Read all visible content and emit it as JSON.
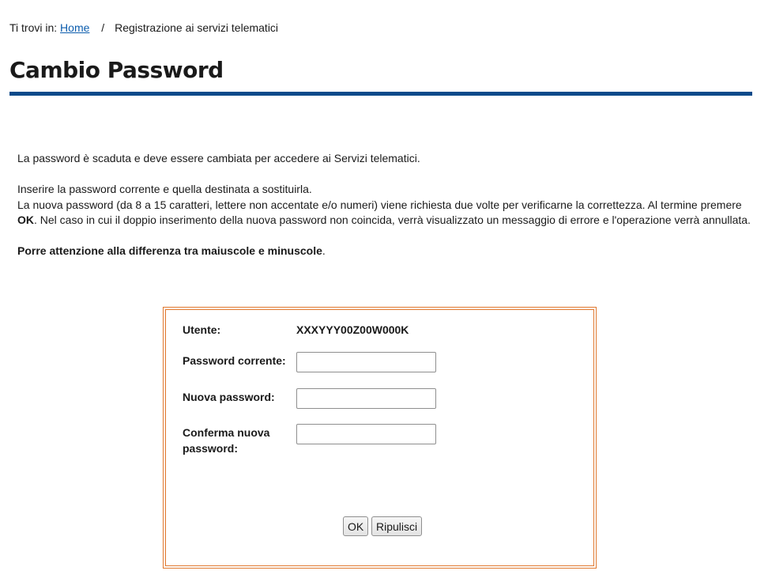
{
  "breadcrumb": {
    "prefix": "Ti trovi in:",
    "home": "Home",
    "separator": "/",
    "current": "Registrazione ai servizi telematici"
  },
  "page": {
    "title": "Cambio Password"
  },
  "intro": {
    "line1": "La password è scaduta e deve essere cambiata per accedere ai Servizi telematici.",
    "line2": "Inserire la password corrente e quella destinata a sostituirla.",
    "line3_a": "La nuova password (da 8 a 15 caratteri, lettere non accentate e/o numeri) viene richiesta due volte per verificarne la correttezza. Al termine premere ",
    "line3_ok": "OK",
    "line3_b": ". Nel caso in cui il doppio inserimento della nuova password non coincida, verrà visualizzato un messaggio di errore e l'operazione verrà annullata.",
    "warning_bold": "Porre attenzione alla differenza tra maiuscole e minuscole",
    "warning_end": "."
  },
  "form": {
    "user_label": "Utente:",
    "user_value": "XXXYYY00Z00W000K",
    "current_password_label": "Password corrente:",
    "current_password_value": "",
    "new_password_label": "Nuova password:",
    "new_password_value": "",
    "confirm_password_label_1": "Conferma nuova",
    "confirm_password_label_2": "password:",
    "confirm_password_value": "",
    "ok_label": "OK",
    "reset_label": "Ripulisci"
  },
  "colors": {
    "title_rule": "#0a4a8a",
    "form_border": "#e0782f",
    "link": "#0b5cad"
  }
}
